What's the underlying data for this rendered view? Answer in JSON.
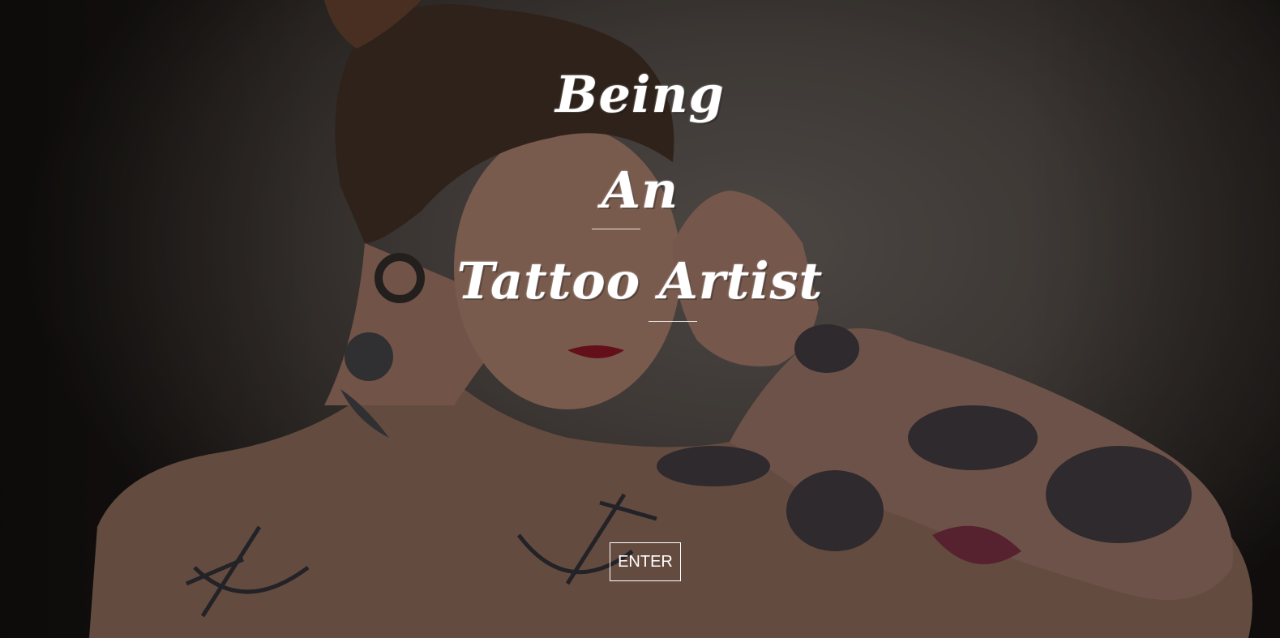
{
  "hero": {
    "title_lines": [
      "Being",
      "An",
      "Tattoo Artist"
    ],
    "enter_label": "ENTER"
  },
  "colors": {
    "text": "#ffffff",
    "background": "#4a4440",
    "skin": "#b98b74",
    "hair": "#3a2a22",
    "ink": "#2a2a30",
    "lips": "#7a1420"
  }
}
